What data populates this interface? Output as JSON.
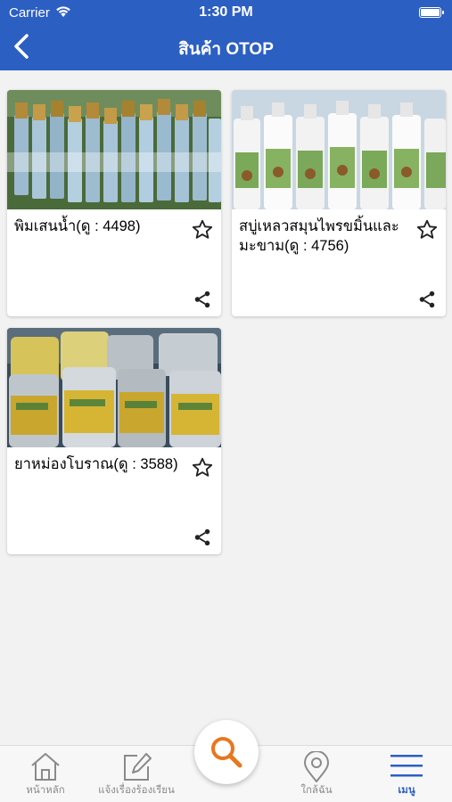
{
  "status_bar": {
    "carrier": "Carrier",
    "time": "1:30 PM"
  },
  "nav": {
    "title": "สินค้า OTOP"
  },
  "products": [
    {
      "title": "พิมเสนน้ำ(ดู : 4498)"
    },
    {
      "title": "สบู่เหลวสมุนไพรขมิ้นและมะขาม(ดู : 4756)"
    },
    {
      "title": "ยาหม่องโบราณ(ดู : 3588)"
    }
  ],
  "tabbar": {
    "home": "หน้าหลัก",
    "report": "แจ้งเรื่องร้องเรียน",
    "nearby": "ใกล้ฉัน",
    "menu": "เมนู"
  },
  "colors": {
    "brand": "#2c5fc2",
    "fab_icon": "#e8771e"
  }
}
